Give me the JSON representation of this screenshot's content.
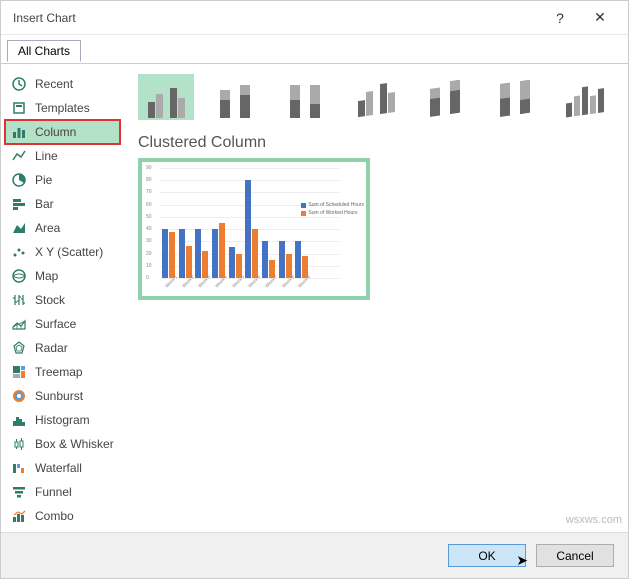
{
  "title": "Insert Chart",
  "tab": "All Charts",
  "sidebar": {
    "items": [
      {
        "label": "Recent"
      },
      {
        "label": "Templates"
      },
      {
        "label": "Column"
      },
      {
        "label": "Line"
      },
      {
        "label": "Pie"
      },
      {
        "label": "Bar"
      },
      {
        "label": "Area"
      },
      {
        "label": "X Y (Scatter)"
      },
      {
        "label": "Map"
      },
      {
        "label": "Stock"
      },
      {
        "label": "Surface"
      },
      {
        "label": "Radar"
      },
      {
        "label": "Treemap"
      },
      {
        "label": "Sunburst"
      },
      {
        "label": "Histogram"
      },
      {
        "label": "Box & Whisker"
      },
      {
        "label": "Waterfall"
      },
      {
        "label": "Funnel"
      },
      {
        "label": "Combo"
      }
    ],
    "selected_index": 2
  },
  "subtype_title": "Clustered Column",
  "colors": {
    "series1": "#4472c4",
    "series2": "#ed7d31",
    "accent": "#b4e2c8",
    "teal": "#2e7d6b"
  },
  "chart_data": {
    "type": "bar",
    "categories": [
      "Week 1",
      "Week 2",
      "Week 3",
      "Week 4",
      "Week 5",
      "Week 6",
      "Week 7",
      "Week 8",
      "Week 9"
    ],
    "series": [
      {
        "name": "Sum of Scheduled Hours",
        "values": [
          40,
          40,
          40,
          40,
          25,
          80,
          30,
          30,
          30
        ]
      },
      {
        "name": "Sum of Worked Hours",
        "values": [
          38,
          26,
          22,
          45,
          20,
          40,
          15,
          20,
          18
        ]
      }
    ],
    "ylim": [
      0,
      90
    ],
    "yticks": [
      0,
      10,
      20,
      30,
      40,
      50,
      60,
      70,
      80,
      90
    ],
    "xlabel": "",
    "ylabel": "",
    "title": ""
  },
  "buttons": {
    "ok": "OK",
    "cancel": "Cancel"
  },
  "watermark": "wsxws.com"
}
